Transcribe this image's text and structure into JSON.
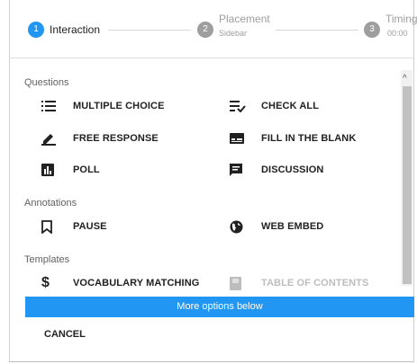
{
  "stepper": {
    "steps": [
      {
        "number": "1",
        "label": "Interaction",
        "sublabel": "",
        "active": true
      },
      {
        "number": "2",
        "label": "Placement",
        "sublabel": "Sidebar",
        "active": false
      },
      {
        "number": "3",
        "label": "Timing",
        "sublabel": "00:00",
        "active": false
      }
    ]
  },
  "sections": {
    "questions": {
      "title": "Questions",
      "items": [
        {
          "label": "MULTIPLE CHOICE",
          "icon": "list-icon"
        },
        {
          "label": "CHECK ALL",
          "icon": "checklist-icon"
        },
        {
          "label": "FREE RESPONSE",
          "icon": "pencil-icon"
        },
        {
          "label": "FILL IN THE BLANK",
          "icon": "blank-icon"
        },
        {
          "label": "POLL",
          "icon": "poll-icon"
        },
        {
          "label": "DISCUSSION",
          "icon": "discussion-icon"
        }
      ]
    },
    "annotations": {
      "title": "Annotations",
      "items": [
        {
          "label": "PAUSE",
          "icon": "bookmark-icon"
        },
        {
          "label": "WEB EMBED",
          "icon": "globe-icon"
        }
      ]
    },
    "templates": {
      "title": "Templates",
      "items": [
        {
          "label": "VOCABULARY MATCHING",
          "icon": "dollar-icon"
        },
        {
          "label": "TABLE OF CONTENTS",
          "icon": "page-icon",
          "disabled": true
        }
      ]
    }
  },
  "more_options": "More options below",
  "cancel_label": "CANCEL",
  "colors": {
    "accent": "#2196f3",
    "inactive_step": "#9e9e9e",
    "disabled_text": "#bdbdbd"
  }
}
